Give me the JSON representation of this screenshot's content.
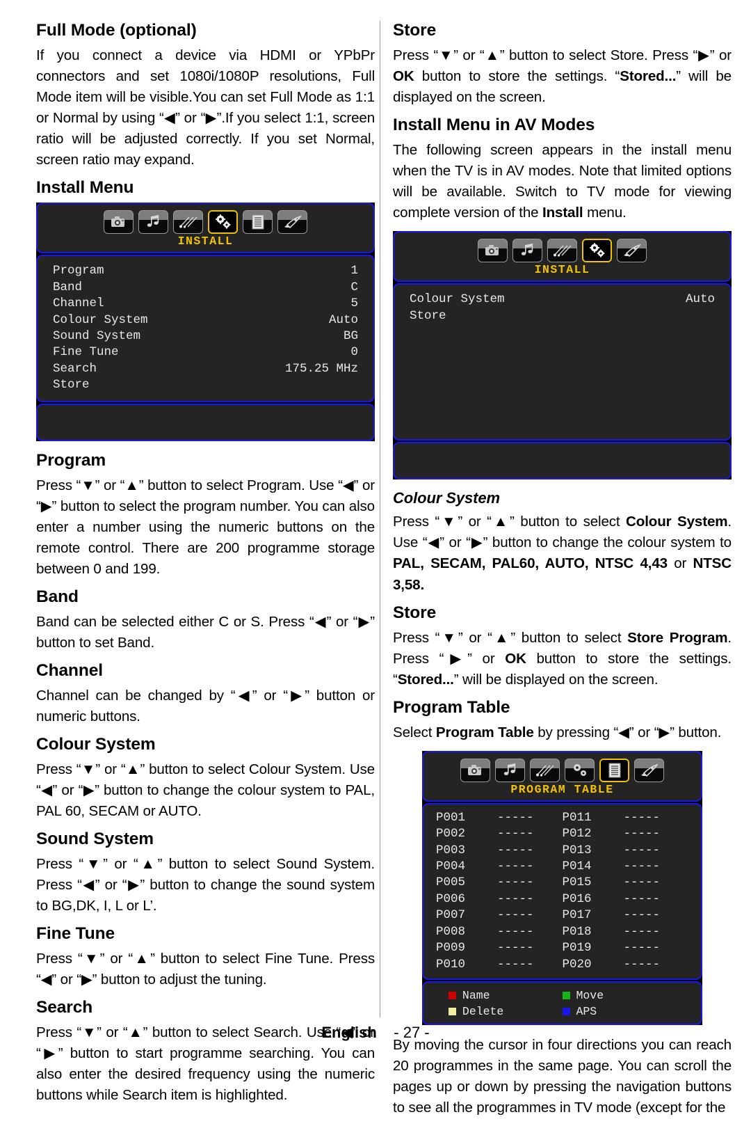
{
  "page": {
    "footer_language": "English",
    "footer_page": "- 27 -",
    "accent_blue": "#1818ee",
    "accent_yellow": "#f2c200",
    "osd_bg": "#242424"
  },
  "left_column": {
    "sections": [
      {
        "heading": "Full Mode (optional)",
        "body": "If you connect a device via HDMI or YPbPr connectors and set 1080i/1080P resolutions, Full Mode item will be visible.You can set Full Mode as 1:1 or Normal by using “◀” or “▶”.If you select 1:1, screen ratio will be adjusted correctly. If you set Normal, screen ratio may expand."
      },
      {
        "heading": "Install Menu",
        "body": ""
      },
      {
        "heading": "Program",
        "body": "Press “▼” or “▲” button to select Program. Use “◀” or “▶” button to select the program number. You can also enter a number using the numeric buttons on the remote control. There are 200 programme storage between 0 and 199."
      },
      {
        "heading": "Band",
        "body": "Band can be selected either C or S. Press “◀” or “▶” button to set Band."
      },
      {
        "heading": "Channel",
        "body": "Channel can be changed by “◀” or “▶” button or numeric buttons."
      },
      {
        "heading": "Colour System",
        "body": "Press “▼” or “▲” button to select Colour System. Use “◀” or “▶” button to change the colour system to PAL, PAL 60, SECAM or AUTO."
      },
      {
        "heading": "Sound System",
        "body": "Press “▼” or “▲” button to select  Sound System. Press “◀” or “▶” button to change the sound system to BG,DK, I, L or L’."
      },
      {
        "heading": "Fine Tune",
        "body": "Press “▼” or “▲” button to select Fine Tune. Press “◀” or “▶” button to adjust the tuning."
      },
      {
        "heading": "Search",
        "body": "Press “▼” or “▲” button to select Search. Use “◀” or “▶” button to start programme searching. You can also enter the desired frequency using the numeric buttons while Search item is highlighted."
      }
    ],
    "install_menu_osd": {
      "title": "INSTALL",
      "icons": [
        "camera-icon",
        "music-note-icon",
        "shooting-star-icon",
        "gears-icon",
        "document-list-icon",
        "rocket-icon"
      ],
      "selected_index": 3,
      "rows": [
        {
          "label": "Program",
          "value": "1"
        },
        {
          "label": "Band",
          "value": "C"
        },
        {
          "label": "Channel",
          "value": "5"
        },
        {
          "label": "Colour System",
          "value": "Auto"
        },
        {
          "label": "Sound System",
          "value": "BG"
        },
        {
          "label": "Fine Tune",
          "value": "0"
        },
        {
          "label": "Search",
          "value": "175.25 MHz"
        },
        {
          "label": "Store",
          "value": ""
        }
      ]
    }
  },
  "right_column": {
    "sections": [
      {
        "heading": "Store",
        "heading_style": "bold",
        "body_html": "Press “▼” or “▲” button to select Store. Press “▶” or <b>OK</b> button to store the settings. “<b>Stored...</b>” will be displayed on the screen."
      },
      {
        "heading": "Install Menu in AV Modes",
        "heading_style": "bold",
        "body_html": "The following screen appears in the install menu when the TV is in AV modes. Note that limited options will be available. Switch to TV mode for viewing complete version of the <b>Install</b> menu."
      },
      {
        "heading": "Colour System",
        "heading_style": "bold-italic",
        "body_html": "Press “▼” or “▲” button to select <b>Colour System</b>. Use “◀” or “▶” button to change the colour system to <b>PAL, SECAM, PAL60, AUTO, NTSC 4,43</b> or <b>NTSC 3,58.</b>"
      },
      {
        "heading": "Store",
        "heading_style": "bold",
        "body_html": "Press “▼” or “▲” button to select <b>Store Program</b>. Press “▶” or <b>OK</b> button to store the settings. “<b>Stored...</b>” will be displayed on the screen."
      },
      {
        "heading": "Program Table",
        "heading_style": "bold",
        "body_html": "Select <b>Program Table</b> by pressing “◀” or “▶” button."
      }
    ],
    "closing_paragraph": "By moving the cursor in four directions you can reach 20 programmes in the same page. You can scroll the pages up or down by pressing the navigation buttons to see all the programmes in TV mode (except for the",
    "av_install_osd": {
      "title": "INSTALL",
      "icons": [
        "camera-icon",
        "music-note-icon",
        "shooting-star-icon",
        "gears-icon",
        "rocket-icon"
      ],
      "selected_index": 3,
      "rows": [
        {
          "label": "Colour System",
          "value": "Auto"
        },
        {
          "label": "Store",
          "value": ""
        }
      ]
    },
    "program_table_osd": {
      "title": "PROGRAM TABLE",
      "icons": [
        "camera-icon",
        "music-note-icon",
        "shooting-star-icon",
        "gears-icon",
        "document-list-icon",
        "rocket-icon"
      ],
      "selected_index": 4,
      "column_left": [
        {
          "num": "P001",
          "name": "-----"
        },
        {
          "num": "P002",
          "name": "-----"
        },
        {
          "num": "P003",
          "name": "-----"
        },
        {
          "num": "P004",
          "name": "-----"
        },
        {
          "num": "P005",
          "name": "-----"
        },
        {
          "num": "P006",
          "name": "-----"
        },
        {
          "num": "P007",
          "name": "-----"
        },
        {
          "num": "P008",
          "name": "-----"
        },
        {
          "num": "P009",
          "name": "-----"
        },
        {
          "num": "P010",
          "name": "-----"
        }
      ],
      "column_right": [
        {
          "num": "P011",
          "name": "-----"
        },
        {
          "num": "P012",
          "name": "-----"
        },
        {
          "num": "P013",
          "name": "-----"
        },
        {
          "num": "P014",
          "name": "-----"
        },
        {
          "num": "P015",
          "name": "-----"
        },
        {
          "num": "P016",
          "name": "-----"
        },
        {
          "num": "P017",
          "name": "-----"
        },
        {
          "num": "P018",
          "name": "-----"
        },
        {
          "num": "P019",
          "name": "-----"
        },
        {
          "num": "P020",
          "name": "-----"
        }
      ],
      "legend": [
        {
          "label": "Name",
          "color": "#d10000"
        },
        {
          "label": "Move",
          "color": "#17b417"
        },
        {
          "label": "Delete",
          "color": "#f2eba0"
        },
        {
          "label": "APS",
          "color": "#1818ee"
        }
      ]
    }
  }
}
